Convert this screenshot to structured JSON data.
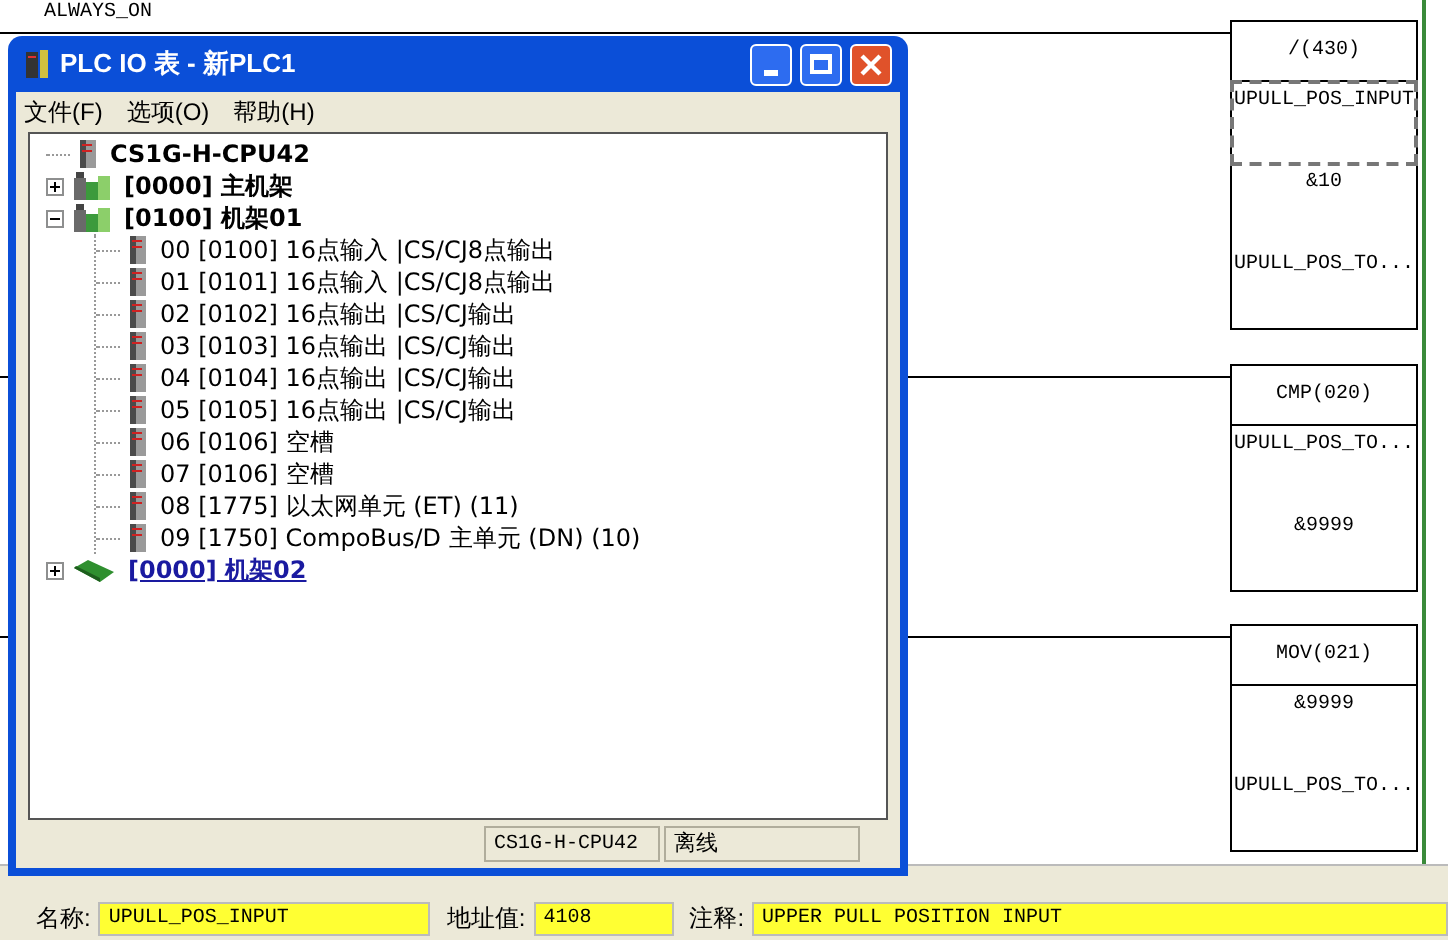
{
  "ladder": {
    "contact_label": "ALWAYS_ON",
    "blocks": [
      {
        "instruction": "/(430)",
        "operands": [
          {
            "text": "UPULL_POS_INPUT",
            "selected": true
          },
          {
            "text": "&10",
            "selected": false
          },
          {
            "text": "UPULL_POS_TO...",
            "selected": false
          }
        ]
      },
      {
        "instruction": "CMP(020)",
        "operands": [
          {
            "text": "UPULL_POS_TO...",
            "selected": false
          },
          {
            "text": "&9999",
            "selected": false
          }
        ]
      },
      {
        "instruction": "MOV(021)",
        "operands": [
          {
            "text": "&9999",
            "selected": false
          },
          {
            "text": "UPULL_POS_TO...",
            "selected": false
          }
        ]
      }
    ]
  },
  "window": {
    "title": "PLC IO 表 - 新PLC1",
    "menu": [
      "文件(F)",
      "选项(O)",
      "帮助(H)"
    ],
    "tree": [
      {
        "kind": "cpu",
        "label": "CS1G-H-CPU42",
        "selected": false
      },
      {
        "kind": "rack",
        "label": "[0000] 主机架",
        "expanded": false,
        "selected": false
      },
      {
        "kind": "rack",
        "label": "[0100] 机架01",
        "expanded": true,
        "selected": false,
        "children": [
          {
            "kind": "unit",
            "label": "00 [0100] 16点输入 |CS/CJ8点输出",
            "selected": false
          },
          {
            "kind": "unit",
            "label": "01 [0101] 16点输入 |CS/CJ8点输出",
            "selected": false
          },
          {
            "kind": "unit",
            "label": "02 [0102] 16点输出 |CS/CJ输出",
            "selected": false
          },
          {
            "kind": "unit",
            "label": "03 [0103] 16点输出 |CS/CJ输出",
            "selected": false
          },
          {
            "kind": "unit",
            "label": "04 [0104] 16点输出 |CS/CJ输出",
            "selected": false
          },
          {
            "kind": "unit",
            "label": "05 [0105] 16点输出 |CS/CJ输出",
            "selected": false
          },
          {
            "kind": "unit",
            "label": "06 [0106] 空槽",
            "selected": false
          },
          {
            "kind": "unit",
            "label": "07 [0106] 空槽",
            "selected": false
          },
          {
            "kind": "unit",
            "label": "08 [1775] 以太网单元 (ET) (11)",
            "selected": false
          },
          {
            "kind": "unit",
            "label": "09 [1750] CompoBus/D 主单元 (DN) (10)",
            "selected": false
          }
        ]
      },
      {
        "kind": "expansion_rack",
        "label": "[0000] 机架02",
        "expanded": false,
        "selected": true
      }
    ],
    "status_bar": [
      "CS1G-H-CPU42",
      "离线"
    ]
  },
  "info_bar": [
    {
      "label": "名称:",
      "value": "UPULL_POS_INPUT"
    },
    {
      "label": "地址值:",
      "value": "4108"
    },
    {
      "label": "注释:",
      "value": "UPPER PULL POSITION INPUT"
    }
  ]
}
